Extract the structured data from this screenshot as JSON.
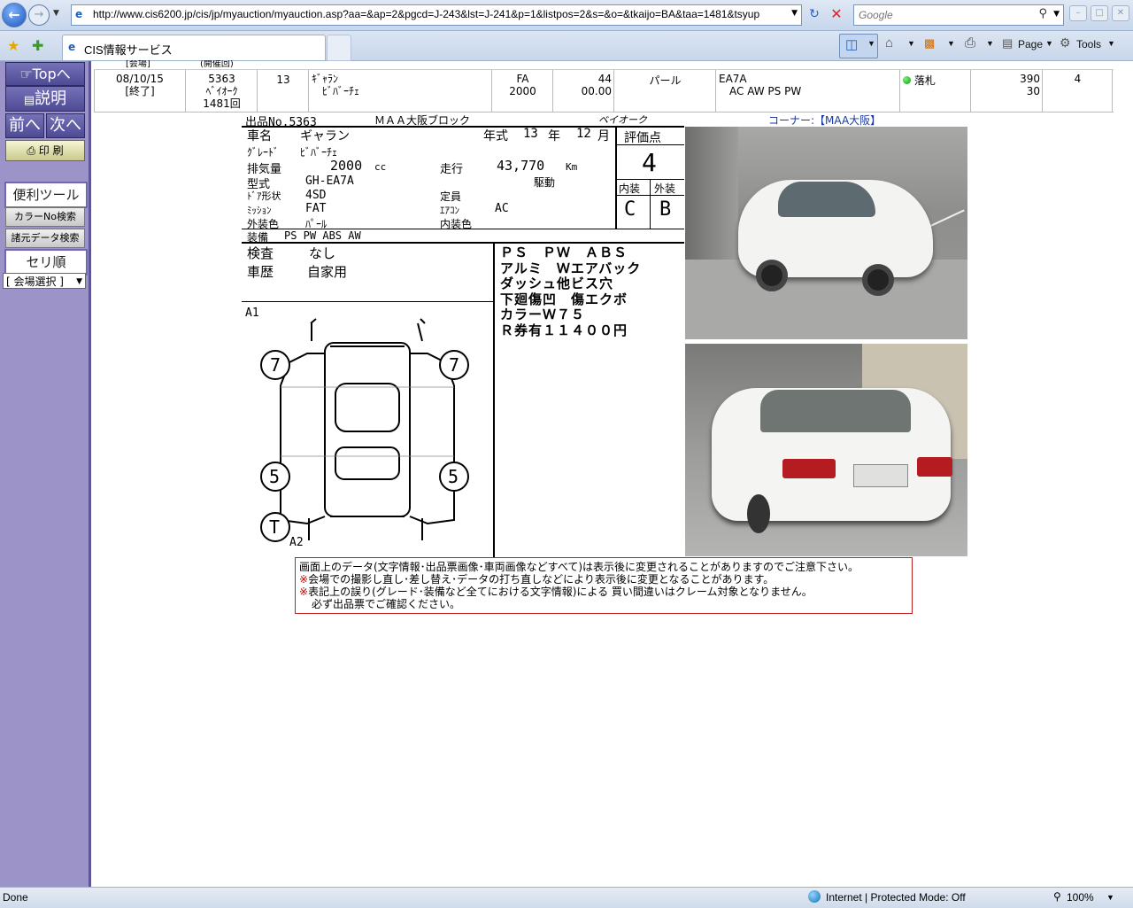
{
  "browser": {
    "url": "http://www.cis6200.jp/cis/jp/myauction/myauction.asp?aa=&ap=2&pgcd=J-243&lst=J-241&p=1&listpos=2&s=&o=&tkaijo=BA&taa=1481&tsyup",
    "search_placeholder": "Google",
    "tab_title": "CIS情報サービス",
    "cmd_page": "Page",
    "cmd_tools": "Tools",
    "status_left": "Done",
    "status_zone": "Internet | Protected Mode: Off",
    "zoom": "100%"
  },
  "sidebar": {
    "top": "Topへ",
    "help": "説明",
    "prev": "前へ",
    "next": "次へ",
    "print": "印 刷",
    "tools_header": "便利ツール",
    "color_search": "カラーNo検索",
    "spec_search": "諸元データ検索",
    "auction_order": "セリ順",
    "venue_select": "[ 会場選択 ]"
  },
  "listing": {
    "header_fragments": [
      "[会場]",
      "(開催回)"
    ],
    "row": {
      "date": "08/10/15",
      "status": "[終了]",
      "lot": "5363",
      "venue": "ﾍﾞｲｵｰｸ",
      "session": "1481回",
      "year": "13",
      "model": "ｷﾞｬﾗﾝ",
      "grade": "ﾋﾞﾊﾞｰﾁｪ",
      "shift": "FA",
      "cc": "2000",
      "mileage": "44",
      "mileage2": "00.00",
      "color": "パール",
      "type": "EA7A",
      "equip": "AC AW PS PW",
      "result": "落札",
      "price": "390",
      "price2": "30",
      "score": "4"
    }
  },
  "sheet": {
    "lot_label": "出品No.5363",
    "block": "ＭＡＡ大阪ブロック",
    "logo": "ベイオーク",
    "corner_label": "コーナー:",
    "corner_value": "【MAA大阪】",
    "car_name_label": "車名",
    "car_name": "ギャラン",
    "year_label": "年式",
    "year": "13",
    "year_unit": "年",
    "month": "12",
    "month_unit": "月",
    "score_label": "評価点",
    "score": "4",
    "grade_label": "ｸﾞﾚｰﾄﾞ",
    "grade": "ﾋﾞﾊﾞｰﾁｪ",
    "disp_label": "排気量",
    "disp": "2000",
    "disp_unit": "cc",
    "mileage_label": "走行",
    "mileage": "43,770",
    "mileage_unit": "Km",
    "drive_label": "駆動",
    "type_label": "型式",
    "type": "GH-EA7A",
    "door_label": "ﾄﾞｱ形状",
    "door": "4SD",
    "capacity_label": "定員",
    "interior_label": "内装",
    "exterior_label": "外装",
    "interior_grade": "C",
    "exterior_grade": "B",
    "mission_label": "ﾐｯｼｮﾝ",
    "mission": "FAT",
    "ac_label": "ｴｱｺﾝ",
    "ac": "AC",
    "ext_color_label": "外装色",
    "ext_color": "ﾊﾟｰﾙ",
    "int_color_label": "内装色",
    "equip_label": "装備",
    "equip": "PS  PW  ABS  AW",
    "inspect_label": "検査",
    "inspect": "なし",
    "history_label": "車歴",
    "history": "自家用",
    "notes": [
      "ＰＳ　ＰＷ　ＡＢＳ",
      "アルミ　Ｗエアバック",
      "ダッシュ他ビス穴",
      "下廻傷凹　傷エクボ",
      "カラーＷ７５",
      "Ｒ券有１１４００円"
    ],
    "diagram_marks": [
      "A1",
      "7",
      "7",
      "5",
      "5",
      "T",
      "A2"
    ]
  },
  "notice": {
    "line1": "画面上のデータ(文字情報･出品票画像･車両画像などすべて)は表示後に変更されることがありますのでご注意下さい。",
    "mark": "※",
    "line2": "会場での撮影し直し･差し替え･データの打ち直しなどにより表示後に変更となることがあります。",
    "line3": "表記上の誤り(グレード･装備など全てにおける文字情報)による 買い間違いはクレーム対象となりません。",
    "line4": "必ず出品票でご確認ください。"
  }
}
